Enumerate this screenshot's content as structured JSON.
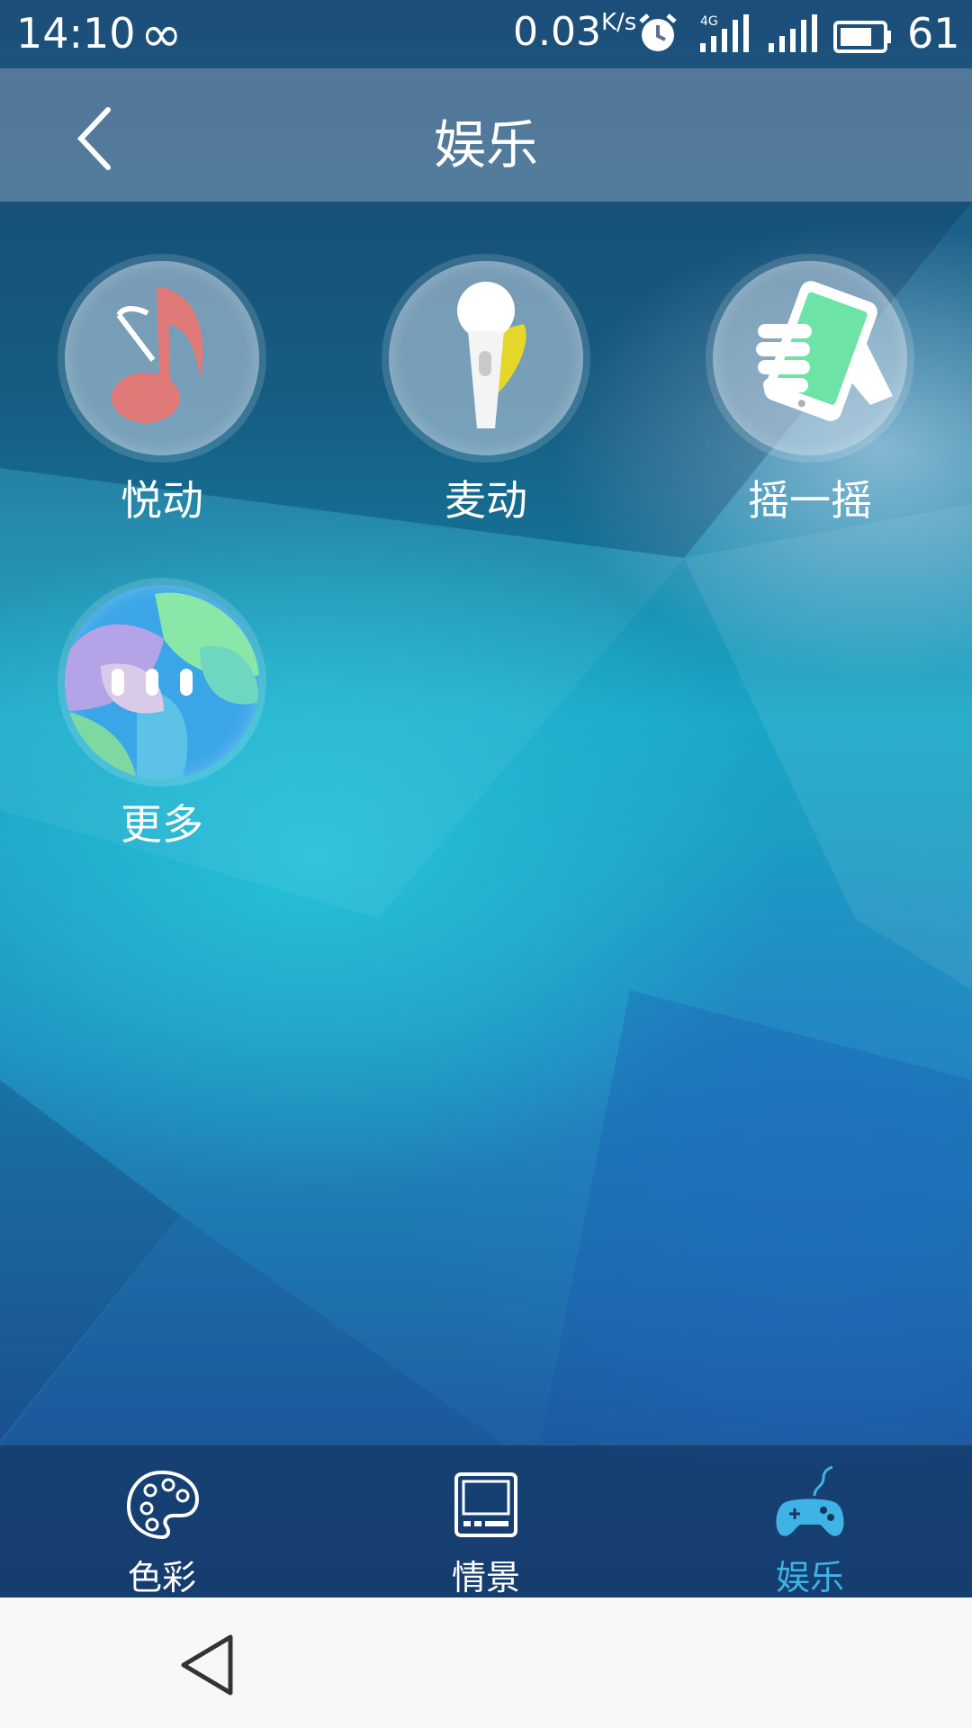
{
  "status_bar": {
    "time": "14:10",
    "infinity_glyph": "∞",
    "speed_value": "0.03",
    "speed_unit": "K/s",
    "network_label": "4G",
    "battery": "61"
  },
  "header": {
    "title": "娱乐"
  },
  "apps": [
    {
      "label": "悦动",
      "icon": "music-note-icon"
    },
    {
      "label": "麦动",
      "icon": "microphone-icon"
    },
    {
      "label": "摇一摇",
      "icon": "shake-phone-icon"
    },
    {
      "label": "更多",
      "icon": "more-icon"
    }
  ],
  "bottom_nav": [
    {
      "label": "色彩",
      "icon": "palette-icon",
      "active": false
    },
    {
      "label": "情景",
      "icon": "scene-tablet-icon",
      "active": false
    },
    {
      "label": "娱乐",
      "icon": "gamepad-icon",
      "active": true
    }
  ],
  "colors": {
    "active_tab": "#3fb2e6",
    "header_bg": "#8296af",
    "music_note": "#e07a78",
    "phone_green": "#6de3a6"
  }
}
